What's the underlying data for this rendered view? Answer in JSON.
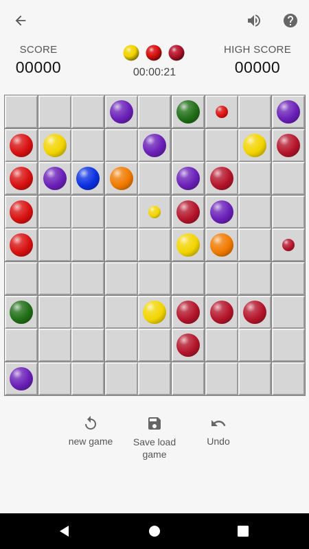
{
  "header": {
    "score_label": "SCORE",
    "score_value": "00000",
    "high_score_label": "HIGH SCORE",
    "high_score_value": "00000",
    "timer": "00:00:21",
    "next_balls": [
      "yellow",
      "red",
      "crimson"
    ]
  },
  "colors": {
    "yellow": "#f2d400",
    "red": "#d81010",
    "crimson": "#b4142a",
    "purple": "#6a1fb8",
    "blue": "#0a2fe0",
    "orange": "#f07a00",
    "green": "#1f6e16"
  },
  "board": {
    "rows": 9,
    "cols": 9,
    "pieces": [
      {
        "row": 0,
        "col": 3,
        "color": "purple",
        "size": "big"
      },
      {
        "row": 0,
        "col": 5,
        "color": "green",
        "size": "big"
      },
      {
        "row": 0,
        "col": 6,
        "color": "red",
        "size": "small"
      },
      {
        "row": 0,
        "col": 8,
        "color": "purple",
        "size": "big"
      },
      {
        "row": 1,
        "col": 0,
        "color": "red",
        "size": "big"
      },
      {
        "row": 1,
        "col": 1,
        "color": "yellow",
        "size": "big"
      },
      {
        "row": 1,
        "col": 4,
        "color": "purple",
        "size": "big"
      },
      {
        "row": 1,
        "col": 7,
        "color": "yellow",
        "size": "big"
      },
      {
        "row": 1,
        "col": 8,
        "color": "crimson",
        "size": "big"
      },
      {
        "row": 2,
        "col": 0,
        "color": "red",
        "size": "big"
      },
      {
        "row": 2,
        "col": 1,
        "color": "purple",
        "size": "big"
      },
      {
        "row": 2,
        "col": 2,
        "color": "blue",
        "size": "big"
      },
      {
        "row": 2,
        "col": 3,
        "color": "orange",
        "size": "big"
      },
      {
        "row": 2,
        "col": 5,
        "color": "purple",
        "size": "big"
      },
      {
        "row": 2,
        "col": 6,
        "color": "crimson",
        "size": "big"
      },
      {
        "row": 3,
        "col": 0,
        "color": "red",
        "size": "big"
      },
      {
        "row": 3,
        "col": 4,
        "color": "yellow",
        "size": "small"
      },
      {
        "row": 3,
        "col": 5,
        "color": "crimson",
        "size": "big"
      },
      {
        "row": 3,
        "col": 6,
        "color": "purple",
        "size": "big"
      },
      {
        "row": 4,
        "col": 0,
        "color": "red",
        "size": "big"
      },
      {
        "row": 4,
        "col": 5,
        "color": "yellow",
        "size": "big"
      },
      {
        "row": 4,
        "col": 6,
        "color": "orange",
        "size": "big"
      },
      {
        "row": 4,
        "col": 8,
        "color": "crimson",
        "size": "small"
      },
      {
        "row": 6,
        "col": 0,
        "color": "green",
        "size": "big"
      },
      {
        "row": 6,
        "col": 4,
        "color": "yellow",
        "size": "big"
      },
      {
        "row": 6,
        "col": 5,
        "color": "crimson",
        "size": "big"
      },
      {
        "row": 6,
        "col": 6,
        "color": "crimson",
        "size": "big"
      },
      {
        "row": 6,
        "col": 7,
        "color": "crimson",
        "size": "big"
      },
      {
        "row": 7,
        "col": 5,
        "color": "crimson",
        "size": "big"
      },
      {
        "row": 8,
        "col": 0,
        "color": "purple",
        "size": "big"
      }
    ]
  },
  "actions": {
    "new_game": "new game",
    "save_load_line1": "Save load",
    "save_load_line2": "game",
    "undo": "Undo"
  },
  "icons": {
    "back": "arrow-back-icon",
    "sound": "volume-icon",
    "help": "help-icon",
    "new_game": "refresh-icon",
    "save": "save-icon",
    "undo": "undo-icon",
    "nav_back": "nav-back-icon",
    "nav_home": "nav-home-icon",
    "nav_recent": "nav-recents-icon"
  }
}
